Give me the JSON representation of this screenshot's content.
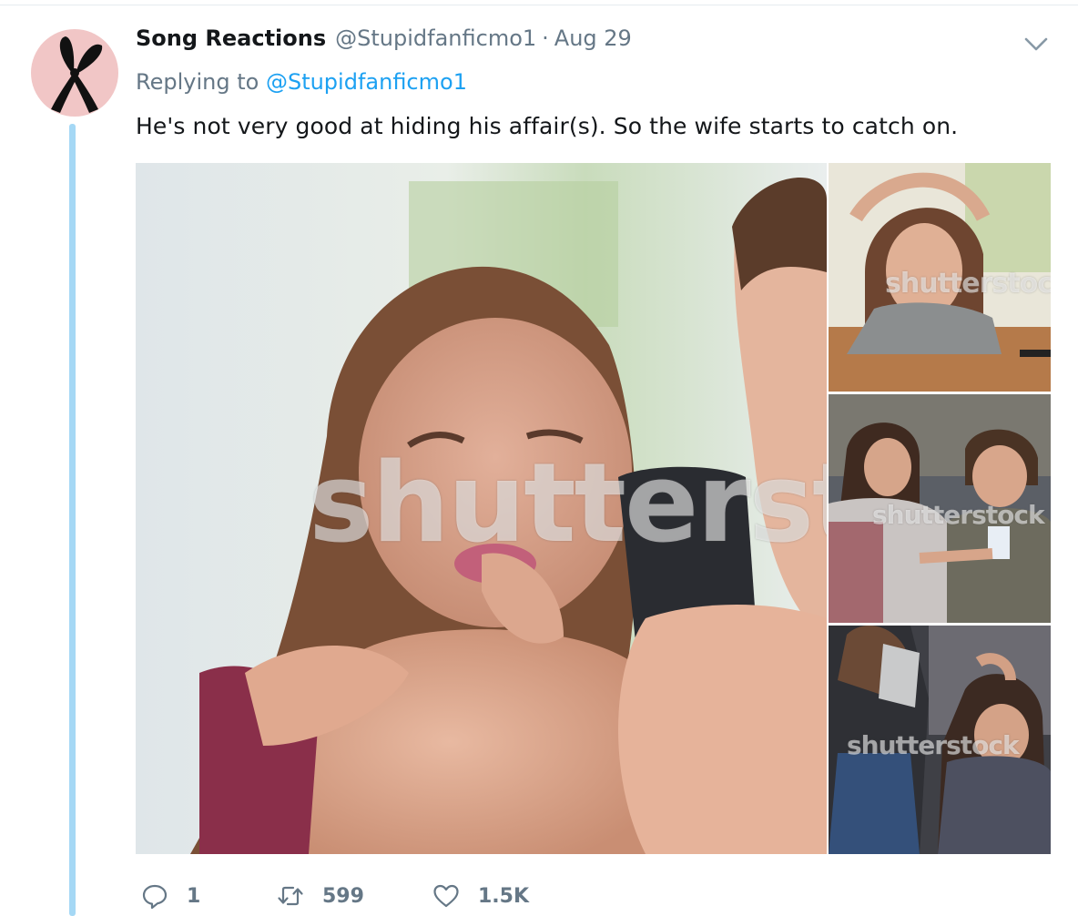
{
  "tweet": {
    "display_name": "Song Reactions",
    "handle": "@Stupidfanficmo1",
    "separator": "·",
    "timestamp": "Aug 29",
    "replying_prefix": "Replying to",
    "replying_to": "@Stupidfanficmo1",
    "text": "He's not very good at hiding his affair(s). So the wife starts to catch on.",
    "avatar_icon": "black-ribbon-bunny-ears-icon",
    "avatar_bg": "#f1c6c6"
  },
  "media": {
    "watermark_main": "shutterst",
    "watermark_s1": "shutterstoc",
    "watermark_s2": "shutterstock",
    "watermark_s3": "shutterstock"
  },
  "actions": {
    "reply_count": "1",
    "retweet_count": "599",
    "like_count": "1.5K"
  },
  "colors": {
    "text": "#14171a",
    "muted": "#657786",
    "link": "#1da1f2",
    "thread_line": "#a5d8f5"
  }
}
